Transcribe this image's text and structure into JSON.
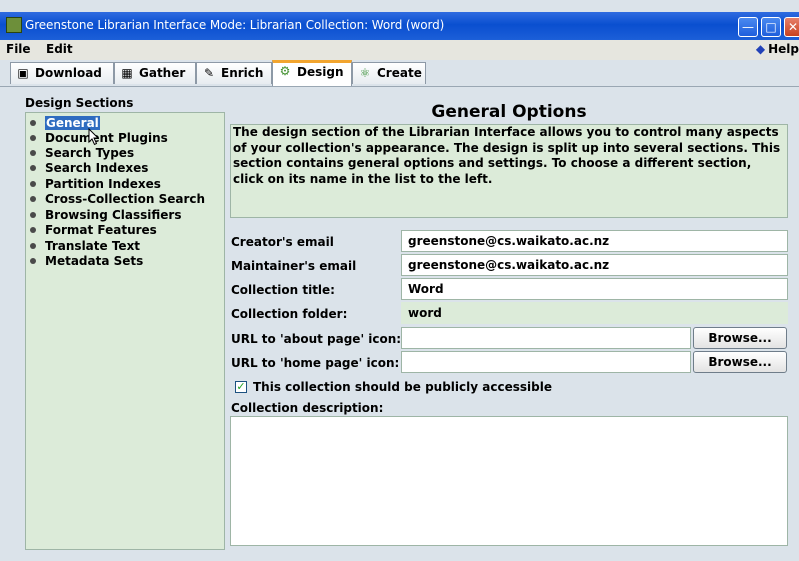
{
  "window": {
    "title": "Greenstone Librarian Interface  Mode: Librarian  Collection: Word (word)"
  },
  "menu": {
    "file": "File",
    "edit": "Edit",
    "help": "Help"
  },
  "tabs": [
    {
      "label": "Download",
      "icon": "download-icon"
    },
    {
      "label": "Gather",
      "icon": "gather-icon"
    },
    {
      "label": "Enrich",
      "icon": "enrich-icon"
    },
    {
      "label": "Design",
      "icon": "design-gear-icon",
      "active": true
    },
    {
      "label": "Create",
      "icon": "create-icon"
    }
  ],
  "sections": {
    "label": "Design Sections",
    "items": [
      {
        "label": "General",
        "selected": true
      },
      {
        "label": "Document Plugins"
      },
      {
        "label": "Search Types"
      },
      {
        "label": "Search Indexes"
      },
      {
        "label": "Partition Indexes"
      },
      {
        "label": "Cross-Collection Search"
      },
      {
        "label": "Browsing Classifiers"
      },
      {
        "label": "Format Features"
      },
      {
        "label": "Translate Text"
      },
      {
        "label": "Metadata Sets"
      }
    ]
  },
  "general": {
    "heading": "General Options",
    "description": "The design section of the Librarian Interface allows you to control many aspects of your collection's appearance. The design is split up into several sections. This section contains general options and settings. To choose a different section, click on its name in the list to the left.",
    "creator_email_label": "Creator's email",
    "creator_email": "greenstone@cs.waikato.ac.nz",
    "maintainer_email_label": "Maintainer's email",
    "maintainer_email": "greenstone@cs.waikato.ac.nz",
    "title_label": "Collection title:",
    "title": "Word",
    "folder_label": "Collection folder:",
    "folder": "word",
    "about_icon_label": "URL to 'about page' icon:",
    "about_icon": "",
    "home_icon_label": "URL to 'home page' icon:",
    "home_icon": "",
    "browse_label": "Browse...",
    "public_label": "This collection should be publicly accessible",
    "public_checked": true,
    "description_label": "Collection description:",
    "collection_description": ""
  },
  "colors": {
    "titlebar": "#0a4fd0",
    "panel": "#dcebd9",
    "selection": "#2f6cc0",
    "active_tab_accent": "#f2a52f"
  }
}
